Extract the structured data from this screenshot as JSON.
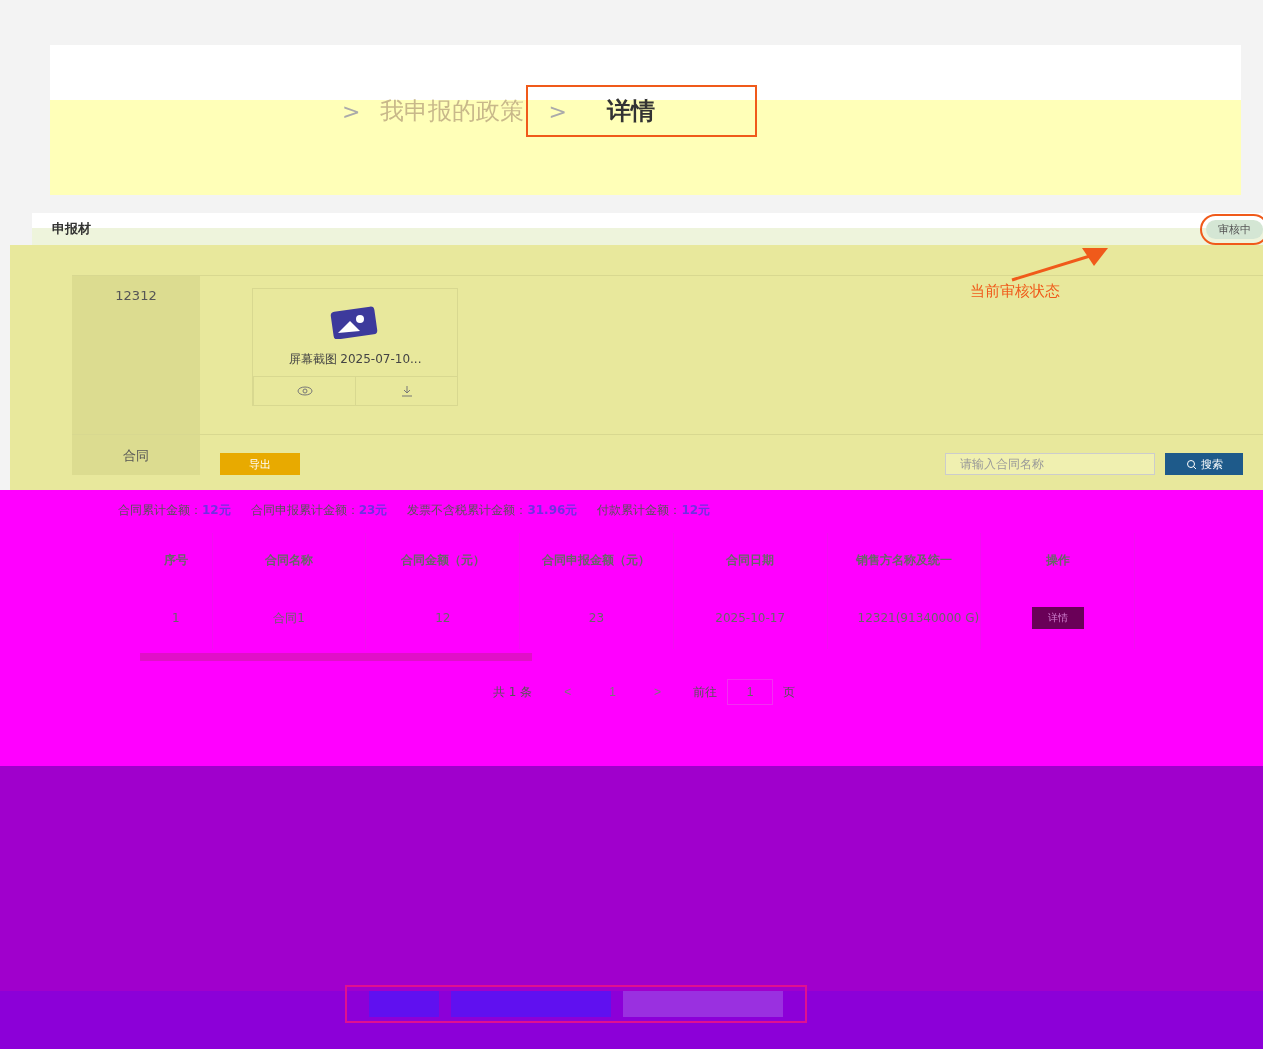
{
  "breadcrumb": {
    "separator": ">",
    "items": [
      {
        "label": "我申报的政策",
        "current": false
      },
      {
        "label": "详情",
        "current": true
      }
    ]
  },
  "section": {
    "title": "申报材",
    "status": "审核中",
    "annotation": "当前审核状态"
  },
  "materials": [
    {
      "label": "12312",
      "files": [
        {
          "name": "屏幕截图 2025-07-10..."
        }
      ]
    }
  ],
  "contracts": {
    "label": "合同",
    "export_button": "导出",
    "search": {
      "placeholder": "请输入合同名称"
    },
    "search_button": "搜索",
    "summary": [
      {
        "label": "合同累计金额：",
        "value": "12元"
      },
      {
        "label": "合同申报累计金额：",
        "value": "23元"
      },
      {
        "label": "发票不含税累计金额：",
        "value": "31.96元"
      },
      {
        "label": "付款累计金额：",
        "value": "12元"
      }
    ],
    "table": {
      "columns": [
        "序号",
        "合同名称",
        "合同金额（元）",
        "合同申报金额（元）",
        "合同日期",
        "销售方名称及统一",
        "操作"
      ],
      "rows": [
        {
          "cells": [
            "1",
            "合同1",
            "12",
            "23",
            "2025-10-17",
            "12321(91340000 G)"
          ],
          "action": "详情"
        }
      ]
    },
    "pagination": {
      "total": "共 1 条",
      "prev": "<",
      "page": "1",
      "next": ">",
      "goto": "前往",
      "goto_value": "1",
      "unit": "页"
    }
  }
}
